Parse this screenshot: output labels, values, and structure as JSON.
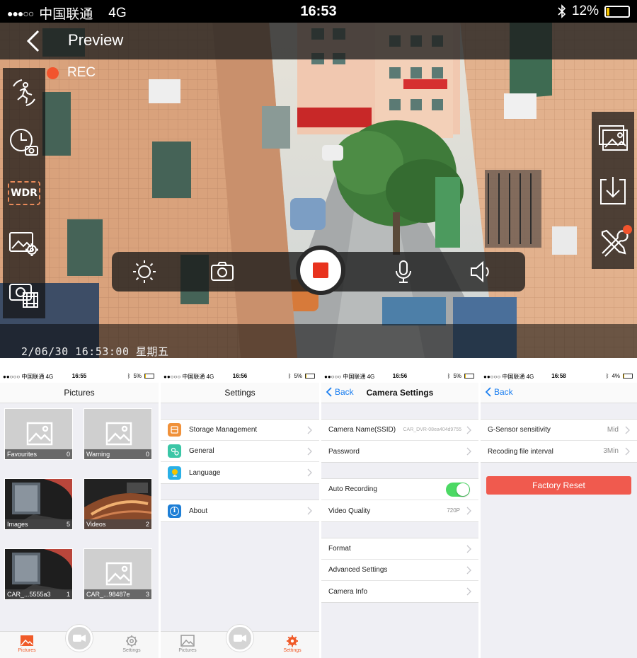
{
  "preview": {
    "status": {
      "carrier": "中国联通",
      "network": "4G",
      "time": "16:53",
      "battery": "12%",
      "battery_level": 0.12
    },
    "title": "Preview",
    "rec_label": "REC",
    "wdr_label": "WDR",
    "datestamp": "2/06/30 16:53:00  星期五"
  },
  "pictures_screen": {
    "status": {
      "carrier": "●●○○○ 中国联通  4G",
      "time": "16:55",
      "battery": "5%",
      "battery_level": 0.05
    },
    "title": "Pictures",
    "albums": [
      {
        "name": "Favourites",
        "count": "0"
      },
      {
        "name": "Warning",
        "count": "0"
      },
      {
        "name": "Images",
        "count": "5"
      },
      {
        "name": "Videos",
        "count": "2"
      },
      {
        "name": "CAR_...5555a3",
        "count": "1"
      },
      {
        "name": "CAR_...98487e",
        "count": "3"
      }
    ],
    "tabs": {
      "pictures": "Pictures",
      "settings": "Settings"
    }
  },
  "settings_screen": {
    "status": {
      "carrier": "●●○○○ 中国联通  4G",
      "time": "16:56",
      "battery": "5%",
      "battery_level": 0.05
    },
    "title": "Settings",
    "items": [
      "Storage Management",
      "General",
      "Language"
    ],
    "about": "About",
    "icon_colors": {
      "storage": "#f0913a",
      "general": "#3ac6a6",
      "language": "#2ab0e6",
      "about": "#1e7fd6"
    },
    "tabs": {
      "pictures": "Pictures",
      "settings": "Settings"
    }
  },
  "camera_settings_screen": {
    "status": {
      "carrier": "●●○○○ 中国联通  4G",
      "time": "16:56",
      "battery": "5%",
      "battery_level": 0.05
    },
    "back": "Back",
    "title": "Camera Settings",
    "camera_name_label": "Camera Name(SSID)",
    "camera_name_value": "CAR_DVR-08ea404d9755",
    "password_label": "Password",
    "auto_recording_label": "Auto Recording",
    "auto_recording_on": true,
    "video_quality_label": "Video Quality",
    "video_quality_value": "720P",
    "format_label": "Format",
    "advanced_label": "Advanced Settings",
    "camera_info_label": "Camera Info"
  },
  "advanced_screen": {
    "status": {
      "carrier": "●●○○○ 中国联通  4G",
      "time": "16:58",
      "battery": "4%",
      "battery_level": 0.04
    },
    "back": "Back",
    "gsensor_label": "G-Sensor sensitivity",
    "gsensor_value": "Mid",
    "interval_label": "Recoding file interval",
    "interval_value": "3Min",
    "factory_reset": "Factory Reset"
  },
  "colors": {
    "accent": "#f05a28",
    "ios_blue": "#1a7ef0",
    "rec_red": "#e8331e",
    "toggle_green": "#4cd964",
    "reset_red": "#f05a4e"
  }
}
